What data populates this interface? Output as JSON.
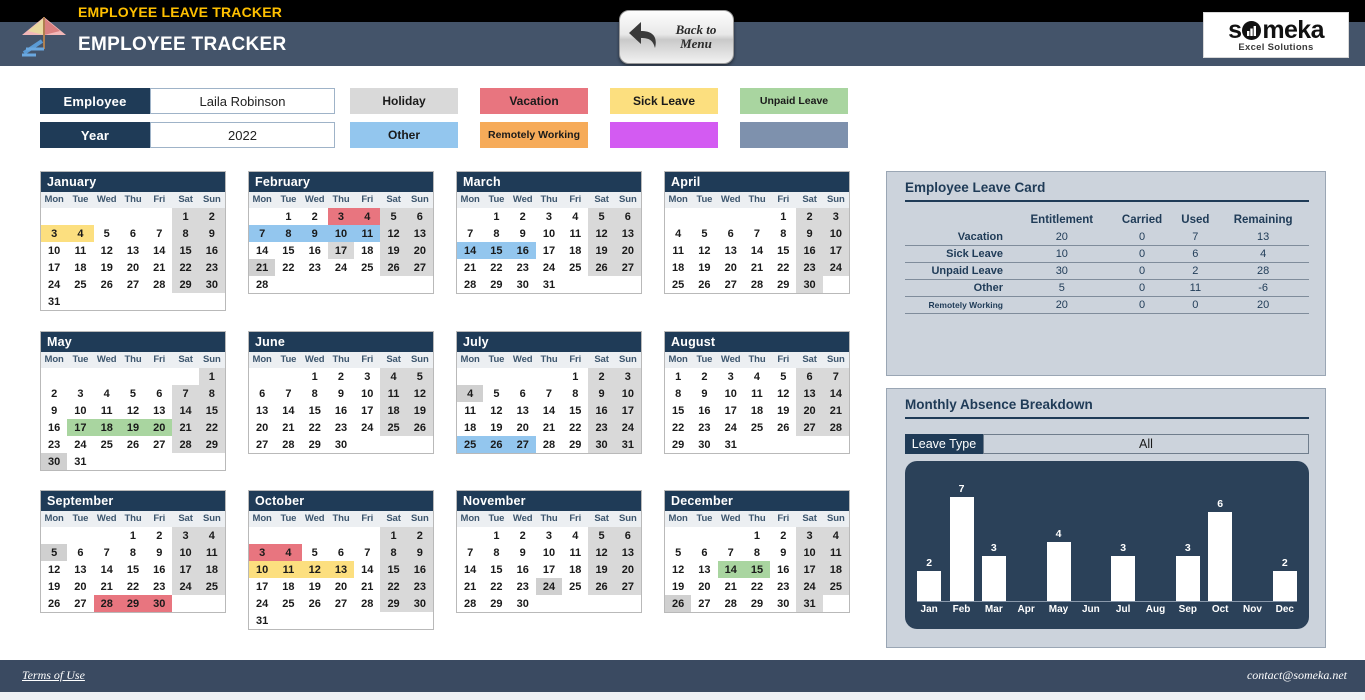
{
  "header": {
    "eyebrow": "EMPLOYEE LEAVE TRACKER",
    "title": "EMPLOYEE TRACKER",
    "back_button": {
      "line1": "Back to",
      "line2": "Menu"
    },
    "logo": {
      "word_start": "s",
      "word_end": "meka",
      "tagline": "Excel Solutions"
    }
  },
  "controls": {
    "employee_label": "Employee",
    "employee_value": "Laila Robinson",
    "year_label": "Year",
    "year_value": "2022",
    "legend": [
      {
        "label": "Holiday",
        "color": "#d9d9d9"
      },
      {
        "label": "Vacation",
        "color": "#e8757f"
      },
      {
        "label": "Sick Leave",
        "color": "#fcdf7f"
      },
      {
        "label": "Unpaid Leave",
        "color": "#a9d5a0"
      },
      {
        "label": "Other",
        "color": "#93c6ee"
      },
      {
        "label": "Remotely Working",
        "color": "#f6ab59"
      },
      {
        "label": "",
        "color": "#d35bf2"
      },
      {
        "label": "",
        "color": "#7e91ad"
      }
    ]
  },
  "calendar": {
    "dow": [
      "Mon",
      "Tue",
      "Wed",
      "Thu",
      "Fri",
      "Sat",
      "Sun"
    ],
    "months": [
      {
        "name": "January",
        "start": 5,
        "days": 31,
        "marks": {
          "3": "#fcdf7f",
          "4": "#fcdf7f"
        }
      },
      {
        "name": "February",
        "start": 1,
        "days": 28,
        "marks": {
          "3": "#e8757f",
          "4": "#e8757f",
          "7": "#93c6ee",
          "8": "#93c6ee",
          "9": "#93c6ee",
          "10": "#93c6ee",
          "11": "#93c6ee",
          "17": "#d9d9d9",
          "21": "#d0d0d0"
        }
      },
      {
        "name": "March",
        "start": 1,
        "days": 31,
        "marks": {
          "14": "#93c6ee",
          "15": "#93c6ee",
          "16": "#93c6ee"
        }
      },
      {
        "name": "April",
        "start": 4,
        "days": 30,
        "marks": {}
      },
      {
        "name": "May",
        "start": 6,
        "days": 31,
        "marks": {
          "17": "#a9d5a0",
          "18": "#a9d5a0",
          "19": "#a9d5a0",
          "20": "#a9d5a0",
          "30": "#d0d0d0"
        }
      },
      {
        "name": "June",
        "start": 2,
        "days": 30,
        "marks": {}
      },
      {
        "name": "July",
        "start": 4,
        "days": 31,
        "marks": {
          "4": "#d0d0d0",
          "25": "#93c6ee",
          "26": "#93c6ee",
          "27": "#93c6ee"
        }
      },
      {
        "name": "August",
        "start": 0,
        "days": 31,
        "marks": {}
      },
      {
        "name": "September",
        "start": 3,
        "days": 30,
        "marks": {
          "5": "#d0d0d0",
          "28": "#e8757f",
          "29": "#e8757f",
          "30": "#e8757f"
        }
      },
      {
        "name": "October",
        "start": 5,
        "days": 31,
        "marks": {
          "3": "#e8757f",
          "4": "#e8757f",
          "10": "#fcdf7f",
          "11": "#fcdf7f",
          "12": "#fcdf7f",
          "13": "#fcdf7f"
        }
      },
      {
        "name": "November",
        "start": 1,
        "days": 30,
        "marks": {
          "24": "#d0d0d0"
        }
      },
      {
        "name": "December",
        "start": 3,
        "days": 31,
        "marks": {
          "14": "#a9d5a0",
          "15": "#a9d5a0",
          "26": "#d0d0d0"
        }
      }
    ]
  },
  "leave_card": {
    "title": "Employee Leave Card",
    "columns": [
      "",
      "Entitlement",
      "Carried",
      "Used",
      "Remaining"
    ],
    "rows": [
      {
        "name": "Vacation",
        "entitlement": "20",
        "carried": "0",
        "used": "7",
        "remaining": "13"
      },
      {
        "name": "Sick Leave",
        "entitlement": "10",
        "carried": "0",
        "used": "6",
        "remaining": "4"
      },
      {
        "name": "Unpaid Leave",
        "entitlement": "30",
        "carried": "0",
        "used": "2",
        "remaining": "28"
      },
      {
        "name": "Other",
        "entitlement": "5",
        "carried": "0",
        "used": "11",
        "remaining": "-6"
      },
      {
        "name": "Remotely Working",
        "entitlement": "20",
        "carried": "0",
        "used": "0",
        "remaining": "20"
      }
    ]
  },
  "breakdown": {
    "title": "Monthly Absence Breakdown",
    "filter_label": "Leave Type",
    "filter_value": "All"
  },
  "chart_data": {
    "type": "bar",
    "title": "Monthly Absence Breakdown",
    "xlabel": "",
    "ylabel": "",
    "ylim": [
      0,
      7
    ],
    "grid": false,
    "legend": "none",
    "categories": [
      "Jan",
      "Feb",
      "Mar",
      "Apr",
      "May",
      "Jun",
      "Jul",
      "Aug",
      "Sep",
      "Oct",
      "Nov",
      "Dec"
    ],
    "values": [
      2,
      7,
      3,
      0,
      4,
      0,
      3,
      0,
      3,
      6,
      0,
      2
    ],
    "bar_color": "#ffffff",
    "plot_background": "#2b4159"
  },
  "footer": {
    "terms": "Terms of Use",
    "contact": "contact@someka.net"
  }
}
